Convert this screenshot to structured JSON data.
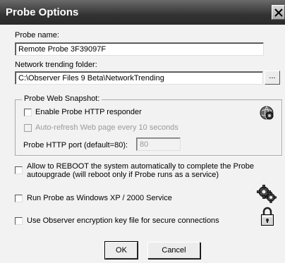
{
  "window": {
    "title": "Probe Options",
    "close_symbol": "✕"
  },
  "probe_name": {
    "label": "Probe name:",
    "value": "Remote Probe 3F39097F"
  },
  "trending_folder": {
    "label": "Network trending folder:",
    "value": "C:\\Observer Files 9 Beta\\NetworkTrending",
    "browse_label": "..."
  },
  "web_snapshot": {
    "group_title": "Probe Web Snapshot:",
    "enable_http_label": "Enable Probe HTTP responder",
    "enable_http_checked": false,
    "auto_refresh_label": "Auto-refresh Web page every 10 seconds",
    "auto_refresh_checked": false,
    "port_label": "Probe HTTP port (default=80):",
    "port_value": "80",
    "icon": "globe-gear-icon"
  },
  "reboot_option": {
    "line1": "Allow to REBOOT the system automatically to complete the Probe",
    "line2": "autoupgrade (will reboot only if Probe runs as a service)",
    "checked": false
  },
  "service_option": {
    "label": "Run Probe as Windows XP / 2000  Service",
    "checked": false,
    "icon": "gears-icon"
  },
  "encryption_option": {
    "label": "Use Observer encryption key file for secure connections",
    "checked": false,
    "icon": "padlock-icon"
  },
  "buttons": {
    "ok_label": "OK",
    "cancel_label": "Cancel"
  }
}
